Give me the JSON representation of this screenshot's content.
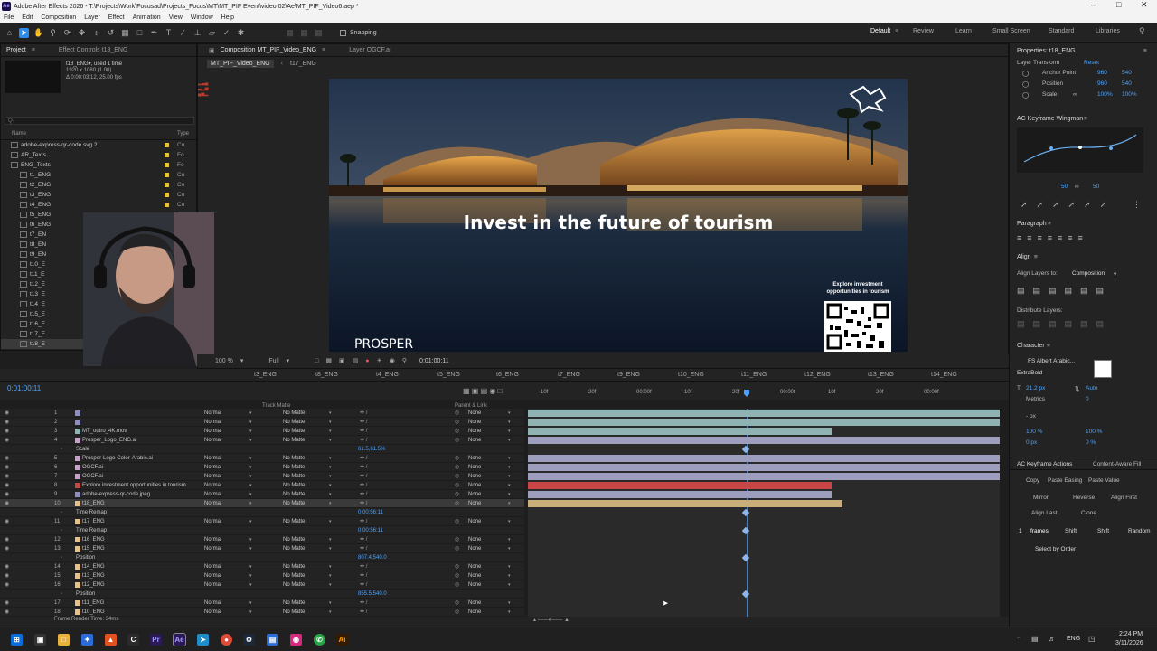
{
  "app": {
    "title": "Adobe After Effects 2026 - T:\\Projects\\Work\\Focusad\\Projects_Focus\\MT\\MT_PIF Event\\video 02\\Ae\\MT_PIF_Video6.aep *",
    "logo": "Ae"
  },
  "menu": [
    "File",
    "Edit",
    "Composition",
    "Layer",
    "Effect",
    "Animation",
    "View",
    "Window",
    "Help"
  ],
  "toolbar": {
    "snapping": "Snapping",
    "workspaces": [
      "Default",
      "Review",
      "Learn",
      "Small Screen",
      "Standard",
      "Libraries"
    ]
  },
  "project": {
    "tab": "Project",
    "effect_tab": "Effect Controls t18_ENG",
    "item_name": "t18_ENG▾, used 1 time",
    "item_size": "1920 x 1080 (1.00)",
    "item_dur": "Δ 0:00:03:12, 25.00 fps",
    "search_placeholder": "Q-",
    "col_name": "Name",
    "col_type": "Type",
    "items": [
      {
        "name": "adobe-express-qr-code.svg 2",
        "type": "Co",
        "indent": 8
      },
      {
        "name": "AR_Texts",
        "type": "Fo",
        "indent": 8
      },
      {
        "name": "ENG_Texts",
        "type": "Fo",
        "indent": 8
      },
      {
        "name": "t1_ENG",
        "type": "Co",
        "indent": 18
      },
      {
        "name": "t2_ENG",
        "type": "Co",
        "indent": 18
      },
      {
        "name": "t3_ENG",
        "type": "Co",
        "indent": 18
      },
      {
        "name": "t4_ENG",
        "type": "Co",
        "indent": 18
      },
      {
        "name": "t5_ENG",
        "type": "Co",
        "indent": 18
      },
      {
        "name": "t6_ENG",
        "type": "Co",
        "indent": 18
      },
      {
        "name": "t7_EN",
        "type": "",
        "indent": 18
      },
      {
        "name": "t8_EN",
        "type": "",
        "indent": 18
      },
      {
        "name": "t9_EN",
        "type": "",
        "indent": 18
      },
      {
        "name": "t10_E",
        "type": "",
        "indent": 18
      },
      {
        "name": "t11_E",
        "type": "",
        "indent": 18
      },
      {
        "name": "t12_E",
        "type": "",
        "indent": 18
      },
      {
        "name": "t13_E",
        "type": "",
        "indent": 18
      },
      {
        "name": "t14_E",
        "type": "",
        "indent": 18
      },
      {
        "name": "t15_E",
        "type": "",
        "indent": 18
      },
      {
        "name": "t16_E",
        "type": "",
        "indent": 18
      },
      {
        "name": "t17_E",
        "type": "",
        "indent": 18
      },
      {
        "name": "t18_E",
        "type": "",
        "indent": 18
      }
    ]
  },
  "viewer": {
    "comp_tab": "Composition MT_PIF_Video_ENG",
    "layer_tab": "Layer OGCF.ai",
    "crumb1": "MT_PIF_Video_ENG",
    "crumb2": "t17_ENG",
    "headline": "Invest in the future of tourism",
    "qr_caption_1": "Explore investment",
    "qr_caption_2": "opportunities in tourism",
    "logo_text": "PROSPER",
    "zoom": "100 %",
    "quality": "Full",
    "timecode_view": "0:01:00:11"
  },
  "timeline": {
    "timecode": "0:01:00:11",
    "frame_render": "Frame Render Time: 34ms",
    "tabs": [
      "t3_ENG",
      "t8_ENG",
      "t4_ENG",
      "t5_ENG",
      "t6_ENG",
      "t7_ENG",
      "t9_ENG",
      "t10_ENG",
      "t11_ENG",
      "t12_ENG",
      "t13_ENG",
      "t14_ENG"
    ],
    "col_track": "Track Matte",
    "col_parent": "Parent & Link",
    "ruler": [
      "10f",
      "20f",
      "00:00f",
      "10f",
      "20f",
      "00:00f",
      "10f",
      "20f",
      "00:00f"
    ],
    "rows": [
      {
        "num": "1",
        "name": "",
        "mode": "Normal",
        "tm": "No Matte",
        "parent": "None",
        "color": "#8f8fbf",
        "kind": "layer"
      },
      {
        "num": "2",
        "name": "",
        "mode": "Normal",
        "tm": "No Matte",
        "parent": "None",
        "color": "#8f8fbf",
        "kind": "layer"
      },
      {
        "num": "3",
        "name": "MT_outro_4K.mov",
        "mode": "Normal",
        "tm": "No Matte",
        "parent": "None",
        "color": "#8fb2b2",
        "kind": "layer"
      },
      {
        "num": "4",
        "name": "Prosper_Logo_ENG.ai",
        "mode": "Normal",
        "tm": "No Matte",
        "parent": "None",
        "color": "#c8a2c8",
        "kind": "layer"
      },
      {
        "num": "",
        "name": "Scale",
        "val": "61.5,61.5%",
        "kind": "prop"
      },
      {
        "num": "5",
        "name": "Prosper-Logo-Color-Arabic.ai",
        "mode": "Normal",
        "tm": "No Matte",
        "parent": "None",
        "color": "#c8a2c8",
        "kind": "layer"
      },
      {
        "num": "6",
        "name": "OGCF.ai",
        "mode": "Normal",
        "tm": "No Matte",
        "parent": "None",
        "color": "#c8a2c8",
        "kind": "layer"
      },
      {
        "num": "7",
        "name": "OGCF.ai",
        "mode": "Normal",
        "tm": "No Matte",
        "parent": "None",
        "color": "#c8a2c8",
        "kind": "layer"
      },
      {
        "num": "8",
        "name": "Explore investment opportunities in tourism",
        "mode": "Normal",
        "tm": "No Matte",
        "parent": "None",
        "color": "#c84646",
        "kind": "layer"
      },
      {
        "num": "9",
        "name": "adobe-express-qr-code.jpeg",
        "mode": "Normal",
        "tm": "No Matte",
        "parent": "None",
        "color": "#8f8fbf",
        "kind": "layer"
      },
      {
        "num": "10",
        "name": "t18_ENG",
        "mode": "Normal",
        "tm": "No Matte",
        "parent": "None",
        "color": "#e4c38a",
        "kind": "layer",
        "sel": true
      },
      {
        "num": "",
        "name": "Time Remap",
        "val": "0:00:56:11",
        "kind": "prop"
      },
      {
        "num": "11",
        "name": "t17_ENG",
        "mode": "Normal",
        "tm": "No Matte",
        "parent": "None",
        "color": "#e4c38a",
        "kind": "layer"
      },
      {
        "num": "",
        "name": "Time Remap",
        "val": "0:00:56:11",
        "kind": "prop"
      },
      {
        "num": "12",
        "name": "t16_ENG",
        "mode": "Normal",
        "tm": "No Matte",
        "parent": "None",
        "color": "#e4c38a",
        "kind": "layer"
      },
      {
        "num": "13",
        "name": "t15_ENG",
        "mode": "Normal",
        "tm": "No Matte",
        "parent": "None",
        "color": "#e4c38a",
        "kind": "layer"
      },
      {
        "num": "",
        "name": "Position",
        "val": "807.4,540.0",
        "kind": "prop"
      },
      {
        "num": "14",
        "name": "t14_ENG",
        "mode": "Normal",
        "tm": "No Matte",
        "parent": "None",
        "color": "#e4c38a",
        "kind": "layer"
      },
      {
        "num": "15",
        "name": "t13_ENG",
        "mode": "Normal",
        "tm": "No Matte",
        "parent": "None",
        "color": "#e4c38a",
        "kind": "layer"
      },
      {
        "num": "16",
        "name": "t12_ENG",
        "mode": "Normal",
        "tm": "No Matte",
        "parent": "None",
        "color": "#e4c38a",
        "kind": "layer"
      },
      {
        "num": "",
        "name": "Position",
        "val": "855.5,540.0",
        "kind": "prop"
      },
      {
        "num": "17",
        "name": "t11_ENG",
        "mode": "Normal",
        "tm": "No Matte",
        "parent": "None",
        "color": "#e4c38a",
        "kind": "layer"
      },
      {
        "num": "18",
        "name": "t10_ENG",
        "mode": "Normal",
        "tm": "No Matte",
        "parent": "None",
        "color": "#e4c38a",
        "kind": "layer"
      }
    ]
  },
  "right": {
    "properties_title": "Properties: t18_ENG",
    "layer_transform": "Layer Transform",
    "reset": "Reset",
    "props": [
      {
        "label": "Anchor Point",
        "v1": "960",
        "v2": "540"
      },
      {
        "label": "Position",
        "v1": "960",
        "v2": "540"
      },
      {
        "label": "Scale",
        "v1": "100%",
        "v2": "100%"
      }
    ],
    "wingman": "AC Keyframe Wingman",
    "wing_vals": [
      "50",
      "50"
    ],
    "paragraph": "Paragraph",
    "align": "Align",
    "align_to_label": "Align Layers to:",
    "align_to": "Composition",
    "distribute": "Distribute Layers:",
    "character": "Character",
    "font": "FS Albert Arabic...",
    "weight": "ExtraBold",
    "size": "21.2 px",
    "leading": "Auto",
    "tracking": "Metrics",
    "tracking_val": "0",
    "unit": "- px",
    "scale_v": "100 %",
    "scale_h": "100 %",
    "baseline": "0 px",
    "tsume": "0 %",
    "kf_actions": "AC Keyframe Actions",
    "content_aware": "Content-Aware Fill",
    "kf_buttons": [
      "Copy",
      "Paste Easing",
      "Paste Value",
      "Mirror",
      "Reverse",
      "Align First",
      "Align Last",
      "Clone"
    ],
    "frames_label": "frames",
    "shift1": "Shift",
    "shift2": "Shift",
    "random": "Random",
    "frames_val": "1",
    "select_by": "Select by Order"
  },
  "taskbar": {
    "lang": "ENG",
    "time": "2:24 PM",
    "date": "3/11/2026"
  }
}
